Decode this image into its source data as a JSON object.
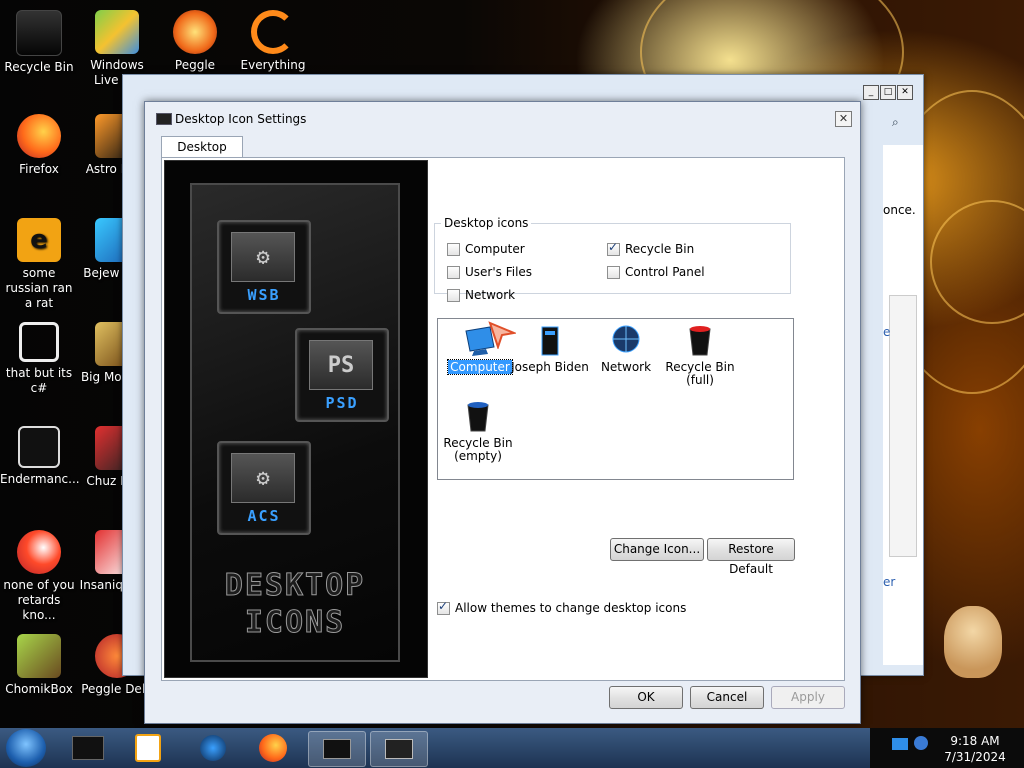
{
  "desktop": {
    "icons": [
      {
        "label": "Recycle Bin",
        "glyph": "recycle-bin-icon"
      },
      {
        "label": "Windows Live Ma",
        "glyph": "windows-live-icon"
      },
      {
        "label": "Peggle World",
        "glyph": "peggle-icon"
      },
      {
        "label": "Everything",
        "glyph": "everything-icon"
      },
      {
        "label": "Firefox",
        "glyph": "firefox-icon"
      },
      {
        "label": "Astro Delu",
        "glyph": "astro-icon"
      },
      {
        "label": "some russian ran a rat",
        "glyph": "document-icon"
      },
      {
        "label": "Bejew Delu",
        "glyph": "bejeweled-icon"
      },
      {
        "label": "that but its c#",
        "glyph": "shortcut-icon"
      },
      {
        "label": "Big Mo Delu",
        "glyph": "game-icon"
      },
      {
        "label": "Endermanc...",
        "glyph": "app-icon"
      },
      {
        "label": "Chuz Delu",
        "glyph": "game-icon"
      },
      {
        "label": "none of you retards kno...",
        "glyph": "firefox-icon"
      },
      {
        "label": "Insaniq Delu",
        "glyph": "game-icon"
      },
      {
        "label": "ChomikBox",
        "glyph": "chomikbox-icon"
      },
      {
        "label": "Peggle Delu",
        "glyph": "peggle-icon"
      }
    ],
    "bg_window_fragments": [
      "once.",
      "e",
      "er"
    ]
  },
  "dialog": {
    "title": "Desktop Icon Settings",
    "close_label": "✕",
    "tab_label": "Desktop Icons",
    "preview": {
      "tiles": [
        {
          "face": "⚙",
          "label": "WSB"
        },
        {
          "face": "PS",
          "label": "PSD"
        },
        {
          "face": "⚙",
          "label": "ACS"
        }
      ],
      "caption_line1": "DESKTOP",
      "caption_line2": "ICONS"
    },
    "group_label": "Desktop icons",
    "checkboxes": {
      "computer": {
        "label": "Computer",
        "checked": false
      },
      "recycle_bin": {
        "label": "Recycle Bin",
        "checked": true
      },
      "users_files": {
        "label": "User's Files",
        "checked": false
      },
      "control_panel": {
        "label": "Control Panel",
        "checked": false
      },
      "network": {
        "label": "Network",
        "checked": false
      }
    },
    "icon_list": [
      {
        "label": "Computer",
        "selected": true
      },
      {
        "label": "Joseph Biden",
        "selected": false
      },
      {
        "label": "Network",
        "selected": false
      },
      {
        "label": "Recycle Bin (full)",
        "selected": false
      },
      {
        "label": "Recycle Bin (empty)",
        "selected": false
      }
    ],
    "change_icon_label": "Change Icon...",
    "restore_default_label": "Restore Default",
    "allow_themes_label": "Allow themes to change desktop icons",
    "allow_themes_checked": true,
    "ok_label": "OK",
    "cancel_label": "Cancel",
    "apply_label": "Apply"
  },
  "taskbar": {
    "time": "9:18 AM",
    "date": "7/31/2024",
    "items": [
      "explorer-icon",
      "media-player-icon",
      "network-globe-icon",
      "firefox-icon",
      "display-icon",
      "monitor-icon"
    ]
  },
  "colors": {
    "selection": "#3399ff",
    "taskbar": "#2a4468",
    "icon_label_blue": "#3aa0ff"
  }
}
